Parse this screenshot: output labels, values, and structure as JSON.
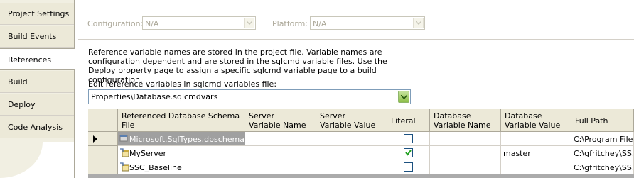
{
  "sidebar": {
    "tabs": [
      {
        "label": "Project Settings"
      },
      {
        "label": "Build Events"
      },
      {
        "label": "References",
        "active": true
      },
      {
        "label": "Build"
      },
      {
        "label": "Deploy"
      },
      {
        "label": "Code Analysis"
      }
    ]
  },
  "config": {
    "configuration_label": "Configuration:",
    "configuration_value": "N/A",
    "platform_label": "Platform:",
    "platform_value": "N/A"
  },
  "references": {
    "description": "Reference variable names are stored in the project file.  Variable names are configuration dependent and are stored in the sqlcmd variable files.  Use the Deploy property page to assign a specific sqlcmd variable page to a build configuration.",
    "edit_label": "Edit reference variables in sqlcmd variables file:",
    "file_value": "Properties\\Database.sqlcmdvars"
  },
  "grid": {
    "columns": [
      "Referenced Database Schema\nFile",
      "Server\nVariable Name",
      "Server\nVariable Value",
      "Literal",
      "Database\nVariable Name",
      "Database\nVariable Value",
      "Full Path"
    ],
    "rows": [
      {
        "file": "Microsoft.SqlTypes.dbschema",
        "server_name": "",
        "server_value": "",
        "literal": false,
        "db_name": "",
        "db_value": "",
        "full_path": "C:\\Program Files...",
        "selected": true
      },
      {
        "file": "MyServer",
        "server_name": "",
        "server_value": "",
        "literal": true,
        "db_name": "",
        "db_value": "master",
        "full_path": "C:\\gfritchey\\SS...",
        "selected": false
      },
      {
        "file": "SSC_Baseline",
        "server_name": "",
        "server_value": "",
        "literal": false,
        "db_name": "",
        "db_value": "",
        "full_path": "C:\\gfritchey\\SS...",
        "selected": false
      }
    ]
  },
  "colors": {
    "tab_bg": "#ece9d8",
    "disabled_text": "#aca899",
    "selected_row": "#a0a0a0",
    "checkbox_border": "#1c5180",
    "check_mark": "#21a121"
  }
}
